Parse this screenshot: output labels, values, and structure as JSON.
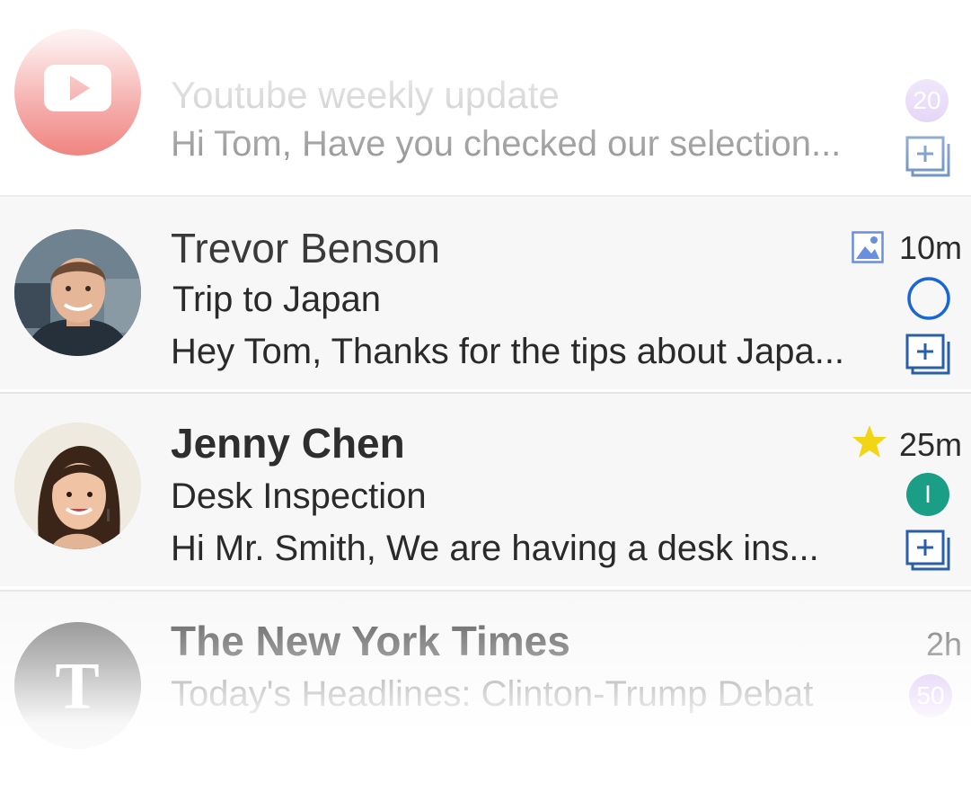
{
  "emails": [
    {
      "sender": "Youtube weekly update",
      "subject": "",
      "snippet": "Hi Tom, Have you checked our selection...",
      "time": "",
      "badge": "20",
      "avatar": "youtube-logo-icon",
      "indicator": "add-to-box-icon"
    },
    {
      "sender": "Trevor Benson",
      "subject": "Trip to Japan",
      "snippet": "Hey Tom, Thanks for the tips about Japa...",
      "time": "10m",
      "attachment": "image-icon",
      "status": "empty-circle-icon",
      "indicator": "add-to-box-icon"
    },
    {
      "sender": "Jenny Chen",
      "subject": "Desk Inspection",
      "snippet": "Hi Mr. Smith, We are having a desk ins...",
      "time": "25m",
      "flag": "star-icon",
      "label_letter": "I",
      "indicator": "add-to-box-icon"
    },
    {
      "sender": "The New York Times",
      "subject": "Today's Headlines: Clinton-Trump Debat",
      "snippet": "",
      "time": "2h",
      "badge": "50",
      "avatar": "nyt-logo-icon"
    }
  ],
  "colors": {
    "accent_blue": "#1a66d6",
    "box_icon_blue": "#2a5fa8",
    "star_yellow": "#f2d515",
    "label_green": "#1a9e86",
    "badge_purple": "#c7a6ee",
    "youtube_red": "#e52d27"
  }
}
